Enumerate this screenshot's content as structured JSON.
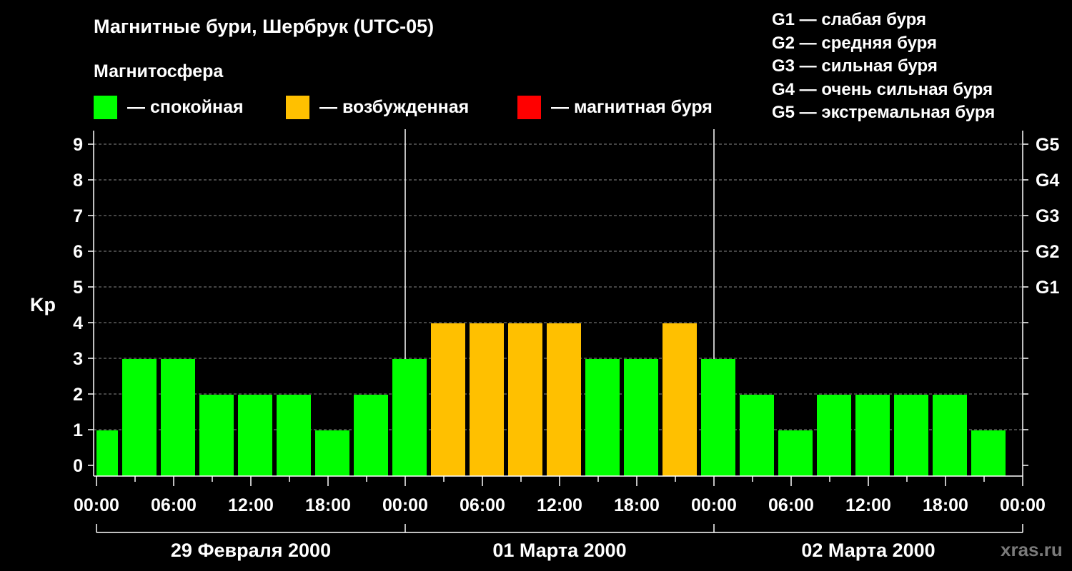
{
  "header": {
    "title": "Магнитные бури, Шербрук (UTC-05)",
    "subtitle": "Магнитосфера"
  },
  "legend": [
    {
      "label": "— спокойная",
      "color": "#00ff00"
    },
    {
      "label": "— возбужденная",
      "color": "#ffc000"
    },
    {
      "label": "— магнитная буря",
      "color": "#ff0000"
    }
  ],
  "g_scale": [
    "G1 — слабая буря",
    "G2 — средняя буря",
    "G3 — сильная буря",
    "G4 — очень сильная буря",
    "G5 — экстремальная буря"
  ],
  "watermark": "xras.ru",
  "chart_data": {
    "type": "bar",
    "ylabel": "Kp",
    "ylim": [
      0,
      9
    ],
    "y_ticks": [
      "0",
      "1",
      "2",
      "3",
      "4",
      "5",
      "6",
      "7",
      "8",
      "9"
    ],
    "right_ticks": [
      {
        "kp": 5,
        "label": "G1"
      },
      {
        "kp": 6,
        "label": "G2"
      },
      {
        "kp": 7,
        "label": "G3"
      },
      {
        "kp": 8,
        "label": "G4"
      },
      {
        "kp": 9,
        "label": "G5"
      }
    ],
    "x_tick_labels": [
      "00:00",
      "06:00",
      "12:00",
      "18:00",
      "00:00",
      "06:00",
      "12:00",
      "18:00",
      "00:00",
      "06:00",
      "12:00",
      "18:00",
      "00:00"
    ],
    "days": [
      "29 Февраля 2000",
      "01 Марта 2000",
      "02 Марта 2000"
    ],
    "hours_per_bar": 3,
    "first_bar_start_hour": -1,
    "values": [
      1,
      3,
      3,
      2,
      2,
      2,
      1,
      2,
      3,
      4,
      4,
      4,
      4,
      3,
      3,
      4,
      3,
      2,
      1,
      2,
      2,
      2,
      2,
      1
    ],
    "colors": {
      "quiet": "#00ff00",
      "active": "#ffc000",
      "storm": "#ff0000"
    },
    "grid": true
  }
}
